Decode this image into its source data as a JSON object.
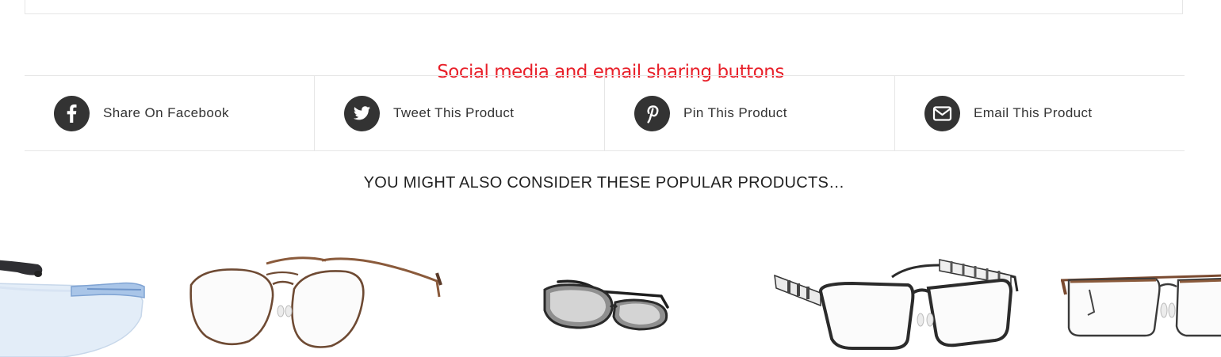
{
  "annotation": "Social media and email sharing buttons",
  "share": {
    "items": [
      {
        "label": "Share On Facebook",
        "icon": "facebook-icon"
      },
      {
        "label": "Tweet This Product",
        "icon": "twitter-icon"
      },
      {
        "label": "Pin This Product",
        "icon": "pinterest-icon"
      },
      {
        "label": "Email This Product",
        "icon": "envelope-icon"
      }
    ]
  },
  "related": {
    "heading": "YOU MIGHT ALSO CONSIDER THESE POPULAR PRODUCTS…",
    "products": [
      {
        "image": "clear-blue-safety-glasses"
      },
      {
        "image": "brown-aviator-eyeglasses"
      },
      {
        "image": "silver-wraparound-sunglasses"
      },
      {
        "image": "black-rectangular-eyeglasses"
      },
      {
        "image": "brown-rectangular-eyeglasses"
      }
    ]
  },
  "colors": {
    "annotation": "#e8202a",
    "icon_circle": "#333333",
    "divider": "#e6e6e6",
    "text": "#333333"
  }
}
